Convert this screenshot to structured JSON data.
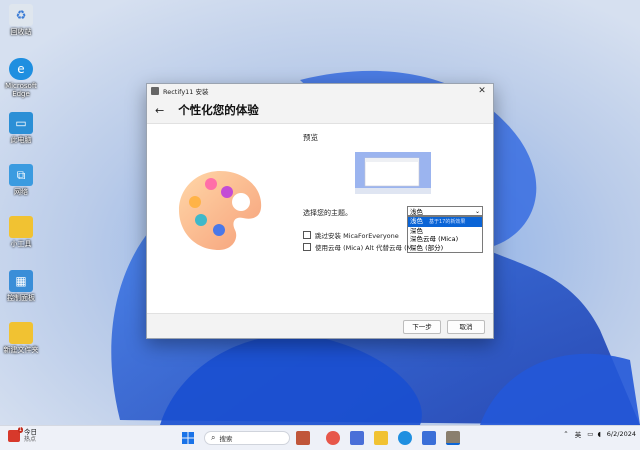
{
  "desktop": {
    "icons": [
      {
        "name": "recycle-bin",
        "label": "回收站",
        "color": "#dfe6ee"
      },
      {
        "name": "edge",
        "label": "Microsoft Edge",
        "color": "#1f8fe0"
      },
      {
        "name": "this-pc",
        "label": "此电脑",
        "color": "#2b8fd6"
      },
      {
        "name": "network",
        "label": "网络",
        "color": "#3b9be0"
      },
      {
        "name": "folder",
        "label": "小工具",
        "color": "#f1c232"
      },
      {
        "name": "control-panel",
        "label": "控制面板",
        "color": "#3a8ed8"
      },
      {
        "name": "new-folder",
        "label": "新建文件夹",
        "color": "#f1c232"
      }
    ]
  },
  "dialog": {
    "window_title": "Rectify11 安装",
    "heading": "个性化您的体验",
    "preview_label": "预览",
    "theme_label": "选择您的主题。",
    "theme_selected": "浅色",
    "theme_options": [
      {
        "label": "浅色",
        "hint": "基于17的新效果"
      },
      {
        "label": "深色",
        "hint": ""
      },
      {
        "label": "深色云母 (Mica)",
        "hint": ""
      },
      {
        "label": "深色 (部分)",
        "hint": ""
      }
    ],
    "checkboxes": [
      {
        "label": "跳过安装 MicaForEveryone",
        "checked": false
      },
      {
        "label": "使用云母 (Mica) Alt 代替云母 (M",
        "checked": false
      }
    ],
    "next_button": "下一步",
    "cancel_button": "取消"
  },
  "taskbar": {
    "weather_title": "今日",
    "weather_sub": "热点",
    "weather_badge": "1",
    "search_placeholder": "搜索",
    "ime": "英",
    "date": "6/2/2024",
    "accent": "#0a64d6"
  }
}
